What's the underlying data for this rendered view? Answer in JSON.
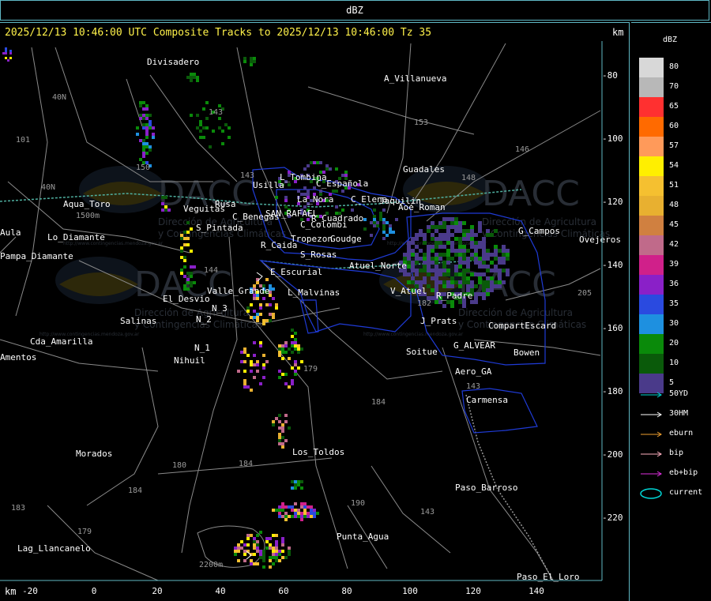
{
  "window": {
    "title": "dBZ"
  },
  "header": {
    "line": "2025/12/13 10:46:00 UTC Composite Tracks to 2025/12/13 10:46:00 Tz 35",
    "km_top": "km",
    "km_bottom": "km"
  },
  "axes": {
    "x_ticks": [
      "-20",
      "0",
      "20",
      "40",
      "60",
      "80",
      "100",
      "120",
      "140"
    ],
    "y_ticks": [
      "-80",
      "-100",
      "-120",
      "-140",
      "-160",
      "-180",
      "-200",
      "-220"
    ]
  },
  "colors": {
    "frame": "#5fb8c4",
    "roads": "#8a8a8a",
    "boundaries": "#1f3bd6",
    "river": "#4fb0a0",
    "header_text": "#fff24a"
  },
  "legend": {
    "title": "dBZ",
    "bins": [
      {
        "label": "80",
        "color": "#d8d8d8"
      },
      {
        "label": "70",
        "color": "#b8b8b8"
      },
      {
        "label": "65",
        "color": "#ff3030"
      },
      {
        "label": "60",
        "color": "#ff6a00"
      },
      {
        "label": "57",
        "color": "#ff9a5a"
      },
      {
        "label": "54",
        "color": "#ffef00"
      },
      {
        "label": "51",
        "color": "#f5c030"
      },
      {
        "label": "48",
        "color": "#e8b030"
      },
      {
        "label": "45",
        "color": "#d08040"
      },
      {
        "label": "42",
        "color": "#c06a8a"
      },
      {
        "label": "39",
        "color": "#d0208a"
      },
      {
        "label": "36",
        "color": "#8a20c8"
      },
      {
        "label": "35",
        "color": "#2a4ae0"
      },
      {
        "label": "30",
        "color": "#1e90e0"
      },
      {
        "label": "20",
        "color": "#0a8a0a"
      },
      {
        "label": "10",
        "color": "#0a5a0a"
      },
      {
        "label": "5",
        "color": "#4a3a8a"
      }
    ],
    "tracks": [
      {
        "label": "50YD",
        "color": "#00d8d8",
        "shape": "arrow"
      },
      {
        "label": "30HM",
        "color": "#ffffff",
        "shape": "arrow"
      },
      {
        "label": "eburn",
        "color": "#f0a030",
        "shape": "arrow"
      },
      {
        "label": "bip",
        "color": "#ffb0c0",
        "shape": "arrow"
      },
      {
        "label": "eb+bip",
        "color": "#e030e0",
        "shape": "arrow"
      },
      {
        "label": "current",
        "color": "#00d8d8",
        "shape": "ellipse"
      }
    ]
  },
  "places": [
    {
      "name": "Divisadero"
    },
    {
      "name": "A_Villanueva"
    },
    {
      "name": "Guadales"
    },
    {
      "name": "L_Tombina"
    },
    {
      "name": "Usilla"
    },
    {
      "name": "C_Española"
    },
    {
      "name": "La_Nora"
    },
    {
      "name": "C_Elena"
    },
    {
      "name": "Jaquilin"
    },
    {
      "name": "Aoe_Roman"
    },
    {
      "name": "Aqua_Toro"
    },
    {
      "name": "Pampa_Diamante"
    },
    {
      "name": "Aula"
    },
    {
      "name": "Rusa"
    },
    {
      "name": "S_Pintada"
    },
    {
      "name": "Veguitas"
    },
    {
      "name": "Lo_Diamante"
    },
    {
      "name": "C_Benegas"
    },
    {
      "name": "SAN_RAFAEL"
    },
    {
      "name": "C_Colombi"
    },
    {
      "name": "R_Cuadrado"
    },
    {
      "name": "Tropezon"
    },
    {
      "name": "Goudge"
    },
    {
      "name": "R_Caida"
    },
    {
      "name": "S_Rosas"
    },
    {
      "name": "Atuel_Norte"
    },
    {
      "name": "E_Escurial"
    },
    {
      "name": "Valle_Grande"
    },
    {
      "name": "L_Malvinas"
    },
    {
      "name": "V_Atuel"
    },
    {
      "name": "R_Padre"
    },
    {
      "name": "El_Desvio"
    },
    {
      "name": "Salinas"
    },
    {
      "name": "N_2"
    },
    {
      "name": "N_3"
    },
    {
      "name": "N_1"
    },
    {
      "name": "Nihuil"
    },
    {
      "name": "Cda_Amarilla"
    },
    {
      "name": "Amentos"
    },
    {
      "name": "J_Prats"
    },
    {
      "name": "CompartEscard"
    },
    {
      "name": "G_ALVEAR"
    },
    {
      "name": "Bowen"
    },
    {
      "name": "Soitue"
    },
    {
      "name": "Aero_GA"
    },
    {
      "name": "Carmensa"
    },
    {
      "name": "G_Campos"
    },
    {
      "name": "Ovejeros"
    },
    {
      "name": "Morados"
    },
    {
      "name": "Los_Toldos"
    },
    {
      "name": "Paso_Barroso"
    },
    {
      "name": "Punta_Agua"
    },
    {
      "name": "Lag_Llancanelo"
    },
    {
      "name": "Paso_El_Loro"
    }
  ],
  "route_labels": [
    "40N",
    "101",
    "40N",
    "143",
    "150",
    "143",
    "153",
    "146",
    "148",
    "144",
    "179",
    "184",
    "180",
    "184",
    "184",
    "183",
    "179",
    "190",
    "143",
    "143",
    "182",
    "205"
  ],
  "elevation_labels": [
    "1500m",
    "2200m"
  ],
  "watermarks": [
    {
      "brand": "DACC",
      "line1": "Dirección de Agricultura",
      "line2": "y Contingencias Climáticas",
      "url": "http://www.contingencias.mendoza.gov.ar"
    },
    {
      "brand": "DACC",
      "line1": "Dirección de Agricultura",
      "line2": "y Contingencias Climáticas",
      "url": "http://www.contingencias.mendoza.gov.ar"
    },
    {
      "brand": "DACC",
      "line1": "Dirección de Agricultura",
      "line2": "y Contingencias Climáticas",
      "url": "http://www.contingencias.mendoza.gov.ar"
    },
    {
      "brand": "DACC",
      "line1": "Dirección de Agricultura",
      "line2": "y Contingencias Climáticas",
      "url": "http://www.contingencias.mendoza.gov.ar"
    }
  ]
}
